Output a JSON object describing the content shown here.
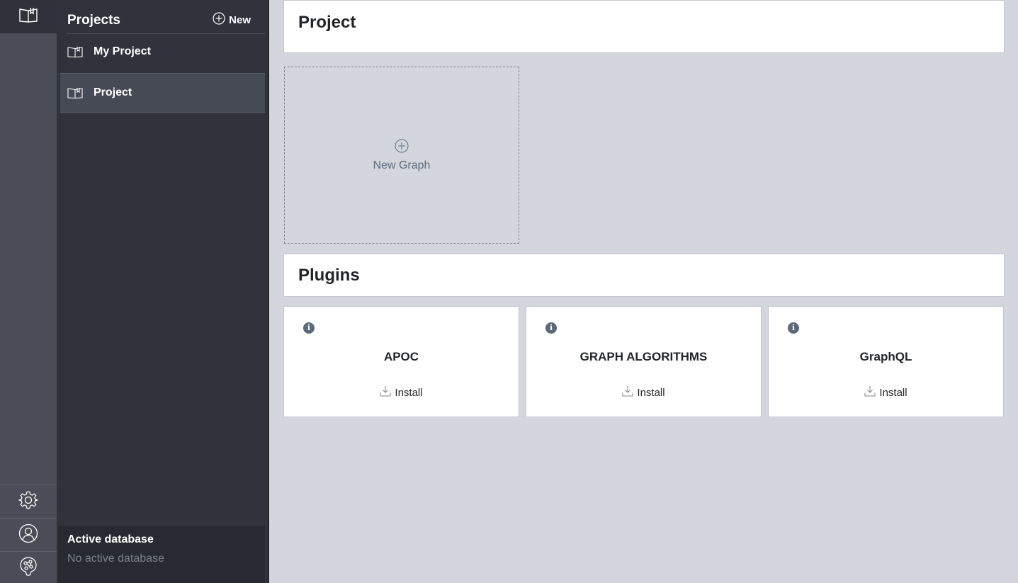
{
  "sidebar": {
    "title": "Projects",
    "new_label": "New",
    "projects": [
      {
        "label": "My Project",
        "active": false
      },
      {
        "label": "Project",
        "active": true
      }
    ],
    "active_db": {
      "title": "Active database",
      "value": "No active database"
    }
  },
  "rail": {
    "top_icon": "projects-book-icon",
    "bottom_icons": [
      "settings-gear-icon",
      "user-account-icon",
      "neo4j-logo-icon"
    ]
  },
  "main": {
    "project_title": "Project",
    "new_graph_label": "New Graph",
    "plugins_title": "Plugins",
    "plugins": [
      {
        "name": "APOC",
        "action": "Install"
      },
      {
        "name": "GRAPH ALGORITHMS",
        "action": "Install"
      },
      {
        "name": "GraphQL",
        "action": "Install"
      }
    ]
  },
  "colors": {
    "rail": "#4a4d57",
    "sidebar": "#30333c",
    "main_bg": "#d3d6dc",
    "accent_text": "#5f6c7e"
  }
}
